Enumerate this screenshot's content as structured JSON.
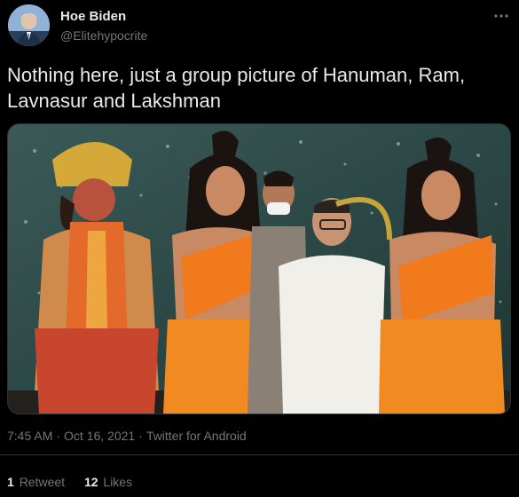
{
  "author": {
    "display_name": "Hoe Biden",
    "handle": "@Elitehypocrite",
    "avatar_icon": "user-avatar"
  },
  "tweet": {
    "text": "Nothing here, just a group picture of Hanuman, Ram, Lavnasur and Lakshman",
    "media": {
      "kind": "photo",
      "alt": ""
    }
  },
  "meta": {
    "time": "7:45 AM",
    "separator": "·",
    "date": "Oct 16, 2021",
    "client": "Twitter for Android"
  },
  "stats": {
    "retweets_count": "1",
    "retweets_label": "Retweet",
    "likes_count": "12",
    "likes_label": "Likes"
  },
  "colors": {
    "background": "#000000",
    "text_primary": "#e7e9ea",
    "text_secondary": "#71767b",
    "divider": "#2f3336"
  }
}
